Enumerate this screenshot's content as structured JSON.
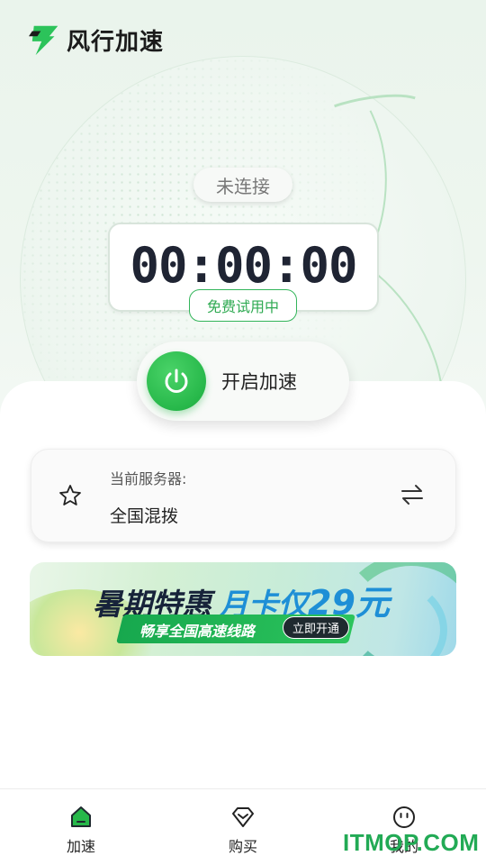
{
  "app": {
    "name": "风行加速"
  },
  "status": {
    "label": "未连接"
  },
  "timer": {
    "value": "00:00:00",
    "badge": "免费试用中"
  },
  "accelerate_button": {
    "label": "开启加速",
    "icon": "power-icon"
  },
  "server": {
    "title": "当前服务器:",
    "value": "全国混拨",
    "icon": "star-icon",
    "switch_icon": "swap-arrows-icon"
  },
  "banner": {
    "headline": "暑期特惠",
    "offer_prefix": "月卡仅",
    "offer_price": "29元",
    "subtitle": "畅享全国高速线路",
    "cta": "立即开通"
  },
  "tabs": [
    {
      "label": "加速",
      "icon": "home-icon",
      "active": true
    },
    {
      "label": "购买",
      "icon": "diamond-icon",
      "active": false
    },
    {
      "label": "我的",
      "icon": "profile-face-icon",
      "active": false
    }
  ],
  "watermark": "ITMOP.COM",
  "colors": {
    "accent": "#27b84a",
    "text": "#222222",
    "timer": "#1f2433"
  }
}
